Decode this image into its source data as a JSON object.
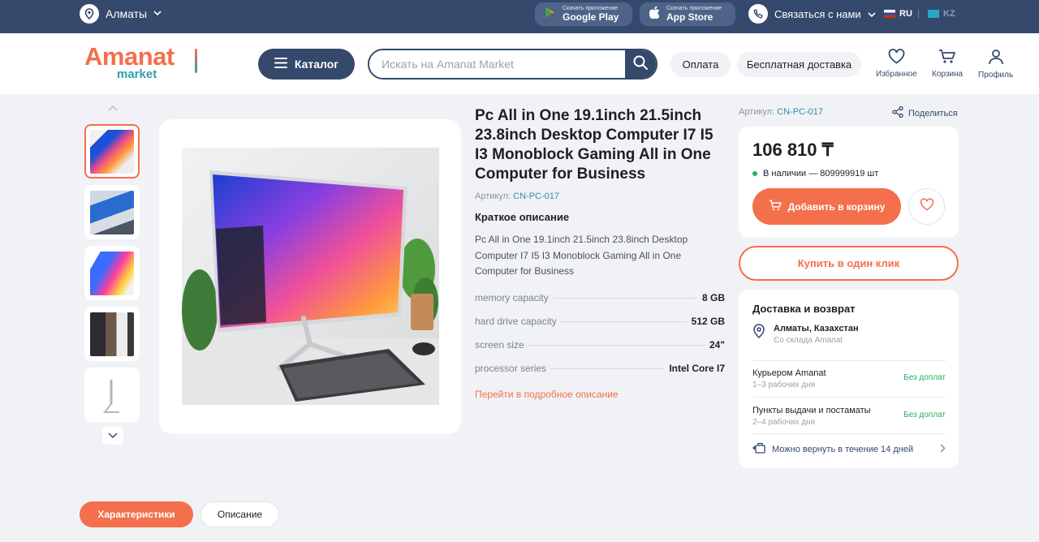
{
  "topbar": {
    "city": "Алматы",
    "google_play": {
      "small": "Скачать приложение",
      "big": "Google Play"
    },
    "app_store": {
      "small": "Скачать приложение",
      "big": "App Store"
    },
    "contact": "Связаться с нами",
    "lang_ru": "RU",
    "lang_kz": "KZ"
  },
  "header": {
    "logo_main": "Amanat",
    "logo_sub": "market",
    "catalog": "Каталог",
    "search_placeholder": "Искать на Amanat Market",
    "payment": "Оплата",
    "free_delivery": "Бесплатная доставка",
    "favorites": "Избранное",
    "cart": "Корзина",
    "profile": "Профиль"
  },
  "product": {
    "title": "Pc All in One 19.1inch 21.5inch 23.8inch Desktop Computer I7 I5 I3 Monoblock Gaming All in One Computer for Business",
    "sku_label": "Артикул:",
    "sku": "CN-PC-017",
    "short_heading": "Краткое описание",
    "short_text": "Pc All in One 19.1inch 21.5inch 23.8inch Desktop Computer I7 I5 I3 Monoblock Gaming All in One Computer for Business",
    "specs": [
      {
        "key": "memory capacity",
        "value": "8 GB"
      },
      {
        "key": "hard drive capacity",
        "value": "512 GB"
      },
      {
        "key": "screen size",
        "value": "24\""
      },
      {
        "key": "processor series",
        "value": "Intel Core I7"
      }
    ],
    "more_link": "Перейти в подробное описание"
  },
  "buy": {
    "share": "Поделиться",
    "price": "106 810 ₸",
    "stock": "В наличии — 809999919 шт",
    "add_to_cart": "Добавить в корзину",
    "one_click": "Купить в один клик"
  },
  "delivery": {
    "heading": "Доставка и возврат",
    "city": "Алматы, Казахстан",
    "warehouse": "Со склада Amanat",
    "options": [
      {
        "name": "Курьером Amanat",
        "days": "1–3 рабочих дня",
        "fee": "Без доплат"
      },
      {
        "name": "Пункты выдачи и постаматы",
        "days": "2–4 рабочих дня",
        "fee": "Без доплат"
      }
    ],
    "return": "Можно вернуть в течение 14 дней"
  },
  "tabs": {
    "specs": "Характеристики",
    "description": "Описание"
  },
  "colors": {
    "navy": "#34496b",
    "accent": "#f46f4c",
    "teal": "#2f9fae",
    "green": "#27ae60"
  }
}
